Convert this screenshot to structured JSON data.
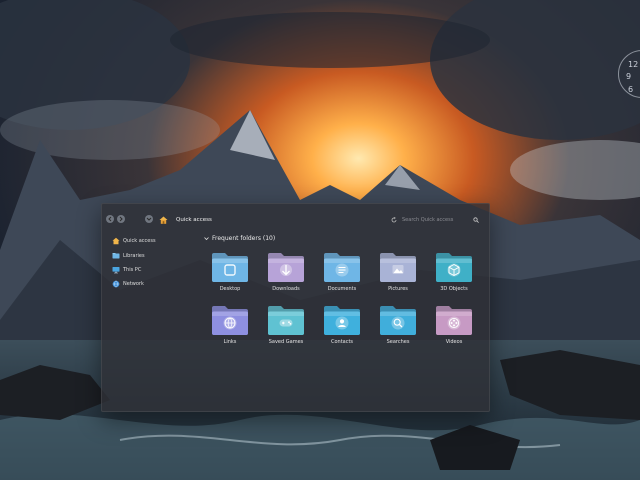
{
  "clock": {
    "digits": [
      "12",
      "9",
      "6"
    ]
  },
  "explorer": {
    "path": "Quick access",
    "search_placeholder": "Search Quick access"
  },
  "sidebar": {
    "items": [
      {
        "label": "Quick access",
        "icon": "star-icon"
      },
      {
        "label": "Libraries",
        "icon": "library-icon"
      },
      {
        "label": "This PC",
        "icon": "monitor-icon"
      },
      {
        "label": "Network",
        "icon": "globe-icon"
      }
    ]
  },
  "main": {
    "section_title": "Frequent folders (10)",
    "folders": [
      {
        "label": "Desktop",
        "icon": "desktop-icon",
        "color": "#6fb6e6"
      },
      {
        "label": "Downloads",
        "icon": "download-icon",
        "color": "#b7a3d8"
      },
      {
        "label": "Documents",
        "icon": "document-icon",
        "color": "#6fb6e6"
      },
      {
        "label": "Pictures",
        "icon": "picture-icon",
        "color": "#a9b3d6"
      },
      {
        "label": "3D Objects",
        "icon": "cube-icon",
        "color": "#3fb0c7"
      },
      {
        "label": "Links",
        "icon": "globe-icon",
        "color": "#8e8fe0"
      },
      {
        "label": "Saved Games",
        "icon": "gamepad-icon",
        "color": "#5fc2d2"
      },
      {
        "label": "Contacts",
        "icon": "contacts-icon",
        "color": "#3fb0dd"
      },
      {
        "label": "Searches",
        "icon": "search-icon",
        "color": "#40aedb"
      },
      {
        "label": "Videos",
        "icon": "film-icon",
        "color": "#c79ac4"
      }
    ]
  }
}
